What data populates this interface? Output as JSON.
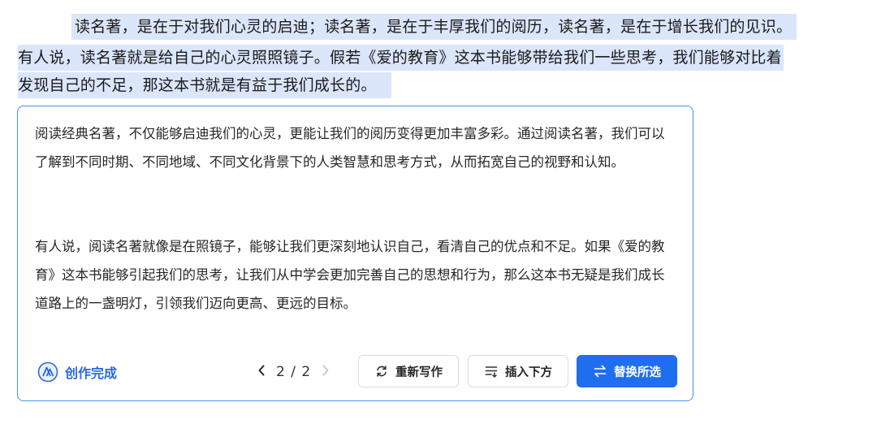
{
  "document": {
    "lines": [
      "读名著，是在于对我们心灵的启迪；读名著，是在于丰厚我们的阅历，读名著，是在于增长我们的见识。",
      "有人说，读名著就是给自己的心灵照照镜子。假若《爱的教育》这本书能够带给我们一些思考，我们能够对比着",
      "发现自己的不足，那这本书就是有益于我们成长的。"
    ],
    "selection_color": "#dbe6fb"
  },
  "panel": {
    "paragraph1": "阅读经典名著，不仅能够启迪我们的心灵，更能让我们的阅历变得更加丰富多彩。通过阅读名著，我们可以了解到不同时期、不同地域、不同文化背景下的人类智慧和思考方式，从而拓宽自己的视野和认知。",
    "paragraph2": "有人说，阅读名著就像是在照镜子，能够让我们更深刻地认识自己，看清自己的优点和不足。如果《爱的教育》这本书能够引起我们的思考，让我们从中学会更加完善自己的思想和行为，那么这本书无疑是我们成长道路上的一盏明灯，引领我们迈向更高、更远的目标。",
    "status_label": "创作完成",
    "status_icon": "ai-logo-icon",
    "pager": {
      "text": "2 / 2",
      "prev_icon": "chevron-left-icon",
      "next_icon": "chevron-right-icon"
    },
    "buttons": {
      "rewrite": "重新写作",
      "insert_below": "插入下方",
      "replace_selection": "替换所选"
    },
    "accent_color": "#1f6ef0",
    "border_color": "#4d8df5"
  }
}
